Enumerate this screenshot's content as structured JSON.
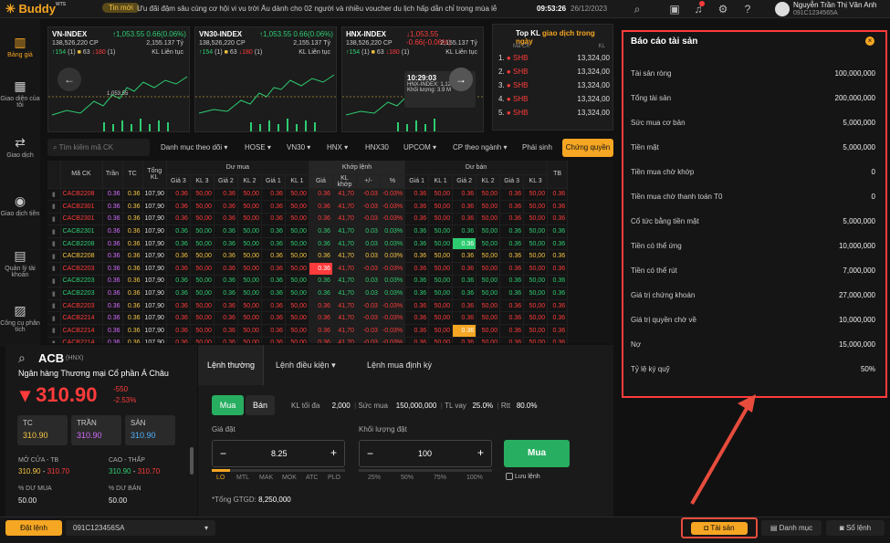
{
  "header": {
    "logo": "Buddy",
    "logo_sup": "WTS",
    "news_badge": "Tin mới",
    "ticker": "Ưu đãi đậm sâu cùng cơ hội vi vu trời Âu dành cho 02 người và nhiều voucher du lịch hấp dẫn chỉ trong mùa lễ",
    "time": "09:53:26",
    "date": "26/12/2023",
    "user_name": "Nguyễn Trần Thị Vân Anh",
    "user_id": "091C1234565A"
  },
  "sidebar": {
    "items": [
      {
        "label": "Bảng giá",
        "icon": "chart-icon"
      },
      {
        "label": "Giao diện của tôi",
        "icon": "grid-icon"
      },
      {
        "label": "Giao dịch",
        "icon": "trade-icon"
      },
      {
        "label": "Giao dịch tiền",
        "icon": "money-icon"
      },
      {
        "label": "Quản lý tài khoản",
        "icon": "account-icon"
      },
      {
        "label": "Công cụ phân tích",
        "icon": "analysis-icon"
      }
    ]
  },
  "indices": [
    {
      "name": "VN-INDEX",
      "value": "↑1,053.55",
      "change": "0.66(0.06%)",
      "volume": "138,526,220",
      "vol_unit": "CP",
      "amount": "2,155.137",
      "amount_unit": "Tỷ",
      "up": "↑154",
      "up_n": "(1)",
      "ref": "63",
      "down": "↓180",
      "down_n": "(1)",
      "status": "KL Liên tục",
      "dir": "up",
      "chart_label": "1,053.55"
    },
    {
      "name": "VN30-INDEX",
      "value": "↑1,053.55",
      "change": "0.66(0.06%)",
      "volume": "138,526,220",
      "vol_unit": "CP",
      "amount": "2,155.137",
      "amount_unit": "Tỷ",
      "up": "↑154",
      "up_n": "(1)",
      "ref": "63",
      "down": "↓180",
      "down_n": "(1)",
      "status": "KL Liên tục",
      "dir": "up",
      "chart_label": ""
    },
    {
      "name": "HNX-INDEX",
      "value": "↓1,053.55",
      "change": "-0.66(-0.06%)",
      "volume": "138,526,220",
      "vol_unit": "CP",
      "amount": "2,155.137",
      "amount_unit": "Tỷ",
      "up": "↑154",
      "up_n": "(1)",
      "ref": "63",
      "down": "↓180",
      "down_n": "(1)",
      "status": "KL Liên tục",
      "dir": "down",
      "chart_label": ""
    }
  ],
  "tooltip": {
    "time": "10:29:03",
    "index": "HNX-INDEX: 1,120.24",
    "volume": "Khối lượng: 3.9 M"
  },
  "top_kl": {
    "title_prefix": "Top KL",
    "title_highlight": "giao dịch trong ngày",
    "col1": "Mã CK",
    "col2": "KL",
    "rows": [
      {
        "rank": "1.",
        "code": "SHB",
        "kl": "13,324,00"
      },
      {
        "rank": "2.",
        "code": "SHB",
        "kl": "13,324,00"
      },
      {
        "rank": "3.",
        "code": "SHB",
        "kl": "13,324,00"
      },
      {
        "rank": "4.",
        "code": "SHB",
        "kl": "13,324,00"
      },
      {
        "rank": "5.",
        "code": "SHB",
        "kl": "13,324,00"
      }
    ]
  },
  "filters": {
    "search_placeholder": "Tìm kiếm mã CK",
    "items": [
      "Danh mục theo dõi ▾",
      "HOSE ▾",
      "VN30 ▾",
      "HNX ▾",
      "HNX30",
      "UPCOM ▾",
      "CP theo ngành ▾",
      "Phái sinh"
    ],
    "active": "Chứng quyền"
  },
  "table": {
    "headers": {
      "ma_ck": "Mã CK",
      "tran": "Trần",
      "tc": "TC",
      "tong_kl": "Tổng KL",
      "du_mua": "Dư mua",
      "khop_lenh": "Khớp lệnh",
      "du_ban": "Dư bán",
      "tb": "TB",
      "sub": [
        "Giá 3",
        "KL 3",
        "Giá 2",
        "KL 2",
        "Giá 1",
        "KL 1",
        "Giá",
        "KL khớp",
        "+/-",
        "%",
        "Giá 1",
        "KL 1",
        "Giá 2",
        "KL 2",
        "Giá 3",
        "KL 3"
      ]
    },
    "rows": [
      {
        "code": "CACB2208",
        "color": "down",
        "cells": [
          "0.36",
          "0.36",
          "107,90",
          "0.36",
          "50,00",
          "0.36",
          "50,00",
          "0.36",
          "50,00",
          "0.36",
          "41,70",
          "-0.03",
          "-0.03%",
          "0.36",
          "50,00",
          "0.36",
          "50,00",
          "0.36",
          "50,00",
          "0.36"
        ],
        "hl": -1
      },
      {
        "code": "CACB2301",
        "color": "down",
        "cells": [
          "0.36",
          "0.36",
          "107,90",
          "0.36",
          "50,00",
          "0.36",
          "50,00",
          "0.36",
          "50,00",
          "0.36",
          "41,70",
          "-0.03",
          "-0.03%",
          "0.36",
          "50,00",
          "0.36",
          "50,00",
          "0.36",
          "50,00",
          "0.36"
        ],
        "hl": -1
      },
      {
        "code": "CACB2301",
        "color": "down",
        "cells": [
          "0.36",
          "0.36",
          "107,90",
          "0.36",
          "50,00",
          "0.36",
          "50,00",
          "0.36",
          "50,00",
          "0.36",
          "41,70",
          "-0.03",
          "-0.03%",
          "0.36",
          "50,00",
          "0.36",
          "50,00",
          "0.36",
          "50,00",
          "0.36"
        ],
        "hl": -1
      },
      {
        "code": "CACB2301",
        "color": "up",
        "cells": [
          "0.36",
          "0.36",
          "107,90",
          "0.36",
          "50,00",
          "0.36",
          "50,00",
          "0.36",
          "50,00",
          "0.36",
          "41,70",
          "0.03",
          "0.03%",
          "0.36",
          "50,00",
          "0.36",
          "50,00",
          "0.36",
          "50,00",
          "0.36"
        ],
        "hl": -1
      },
      {
        "code": "CACB2208",
        "color": "up",
        "cells": [
          "0.36",
          "0.36",
          "107,90",
          "0.36",
          "50,00",
          "0.36",
          "50,00",
          "0.36",
          "50,00",
          "0.36",
          "41,70",
          "0.03",
          "0.03%",
          "0.36",
          "50,00",
          "0.36",
          "50,00",
          "0.36",
          "50,00",
          "0.36"
        ],
        "hl": 14
      },
      {
        "code": "CACB2208",
        "color": "ref",
        "cells": [
          "0.36",
          "0.36",
          "107,90",
          "0.36",
          "50,00",
          "0.36",
          "50,00",
          "0.36",
          "50,00",
          "0.36",
          "41,70",
          "0.03",
          "0.03%",
          "0.36",
          "50,00",
          "0.36",
          "50,00",
          "0.36",
          "50,00",
          "0.36"
        ],
        "hl": -1
      },
      {
        "code": "CACB2203",
        "color": "down",
        "cells": [
          "0.36",
          "0.36",
          "107,90",
          "0.36",
          "50,00",
          "0.36",
          "50,00",
          "0.36",
          "50,00",
          "0.36",
          "41,70",
          "-0.03",
          "-0.03%",
          "0.36",
          "50,00",
          "0.36",
          "50,00",
          "0.36",
          "50,00",
          "0.36"
        ],
        "hl": 8
      },
      {
        "code": "CACB2203",
        "color": "up",
        "cells": [
          "0.36",
          "0.36",
          "107,90",
          "0.36",
          "50,00",
          "0.36",
          "50,00",
          "0.36",
          "50,00",
          "0.36",
          "41,70",
          "0.03",
          "0.03%",
          "0.36",
          "50,00",
          "0.36",
          "50,00",
          "0.36",
          "50,00",
          "0.36"
        ],
        "hl": -1
      },
      {
        "code": "CACB2203",
        "color": "up",
        "cells": [
          "0.36",
          "0.36",
          "107,90",
          "0.36",
          "50,00",
          "0.36",
          "50,00",
          "0.36",
          "50,00",
          "0.36",
          "41,70",
          "0.03",
          "0.03%",
          "0.36",
          "50,00",
          "0.36",
          "50,00",
          "0.36",
          "50,00",
          "0.36"
        ],
        "hl": -1
      },
      {
        "code": "CACB2203",
        "color": "down",
        "cells": [
          "0.36",
          "0.36",
          "107,90",
          "0.36",
          "50,00",
          "0.36",
          "50,00",
          "0.36",
          "50,00",
          "0.36",
          "41,70",
          "-0.03",
          "-0.03%",
          "0.36",
          "50,00",
          "0.36",
          "50,00",
          "0.36",
          "50,00",
          "0.36"
        ],
        "hl": -1
      },
      {
        "code": "CACB2214",
        "color": "down",
        "cells": [
          "0.36",
          "0.36",
          "107,90",
          "0.36",
          "50,00",
          "0.36",
          "50,00",
          "0.36",
          "50,00",
          "0.36",
          "41,70",
          "-0.03",
          "-0.03%",
          "0.36",
          "50,00",
          "0.36",
          "50,00",
          "0.36",
          "50,00",
          "0.36"
        ],
        "hl": -1
      },
      {
        "code": "CACB2214",
        "color": "down",
        "cells": [
          "0.36",
          "0.36",
          "107,90",
          "0.36",
          "50,00",
          "0.36",
          "50,00",
          "0.36",
          "50,00",
          "0.36",
          "41,70",
          "-0.03",
          "-0.03%",
          "0.36",
          "50,00",
          "0.36",
          "50,00",
          "0.36",
          "50,00",
          "0.36"
        ],
        "hl": 14
      },
      {
        "code": "CACB2214",
        "color": "down",
        "cells": [
          "0.36",
          "0.36",
          "107,90",
          "0.36",
          "50,00",
          "0.36",
          "50,00",
          "0.36",
          "50,00",
          "0.36",
          "41,70",
          "-0.03",
          "-0.03%",
          "0.36",
          "50,00",
          "0.36",
          "50,00",
          "0.36",
          "50,00",
          "0.36"
        ],
        "hl": -1
      }
    ]
  },
  "stock": {
    "code": "ACB",
    "exchange": "(HNX)",
    "name": "Ngân hàng Thương mại Cổ phần Á Châu",
    "price": "310.90",
    "change": "-550",
    "pct": "-2.53%",
    "tc_label": "TC",
    "tc": "310.90",
    "tran_label": "TRẦN",
    "tran": "310.90",
    "san_label": "SÀN",
    "san": "310.90",
    "open_label": "MỞ CỬA - TB",
    "open1": "310.90",
    "open2": "310.70",
    "hl_label": "CAO - THẤP",
    "high": "310.90",
    "low": "310.70",
    "buy_label": "% DƯ MUA",
    "buy": "50.00",
    "sell_label": "% DƯ BÁN",
    "sell": "50.00"
  },
  "order": {
    "tabs": [
      "Lệnh thường",
      "Lệnh điều kiện",
      "Lệnh mua định kỳ"
    ],
    "buy": "Mua",
    "sell": "Bán",
    "kl_max_label": "KL tối đa",
    "kl_max": "2,000",
    "suc_mua_label": "Sức mua",
    "suc_mua": "150,000,000",
    "tl_vay_label": "TL vay",
    "tl_vay": "25.0%",
    "rtt_label": "Rtt",
    "rtt": "80.0%",
    "price_label": "Giá đặt",
    "price": "8.25",
    "qty_label": "Khối lượng đặt",
    "qty": "100",
    "order_types": [
      "LO",
      "MTL",
      "MAK",
      "MOK",
      "ATC",
      "PLO"
    ],
    "pcts": [
      "25%",
      "50%",
      "75%",
      "100%"
    ],
    "submit": "Mua",
    "save_label": "Lưu lệnh",
    "total_label": "*Tổng GTGD:",
    "total": "8,250,000"
  },
  "asset": {
    "title": "Báo cáo tài sản",
    "rows": [
      {
        "label": "Tài sản ròng",
        "value": "100,000,000"
      },
      {
        "label": "Tổng tài sản",
        "value": "200,000,000"
      },
      {
        "label": "Sức mua cơ bản",
        "value": "5,000,000"
      },
      {
        "label": "Tiền mặt",
        "value": "5,000,000"
      },
      {
        "label": "Tiền mua chờ khớp",
        "value": "0"
      },
      {
        "label": "Tiền mua chờ thanh toán T0",
        "value": "0"
      },
      {
        "label": "Cổ tức bằng tiền mặt",
        "value": "5,000,000"
      },
      {
        "label": "Tiền có thể ứng",
        "value": "10,000,000"
      },
      {
        "label": "Tiền có thể rút",
        "value": "7,000,000"
      },
      {
        "label": "Giá trị chứng khoán",
        "value": "27,000,000"
      },
      {
        "label": "Giá trị quyền chờ về",
        "value": "10,000,000"
      },
      {
        "label": "Nợ",
        "value": "15,000,000"
      },
      {
        "label": "Tỷ lệ ký quỹ",
        "value": "50%"
      }
    ]
  },
  "bottom": {
    "dat_lenh": "Đặt lệnh",
    "account": "091C123456SA",
    "tai_san": "Tài sản",
    "danh_muc": "Danh mục",
    "so_lenh": "Sổ lệnh"
  },
  "colors": {
    "accent": "#f5a623",
    "up": "#2ecc71",
    "down": "#ff3b3b",
    "ref": "#f5c542",
    "highlight_red": "#ff3b3b"
  }
}
